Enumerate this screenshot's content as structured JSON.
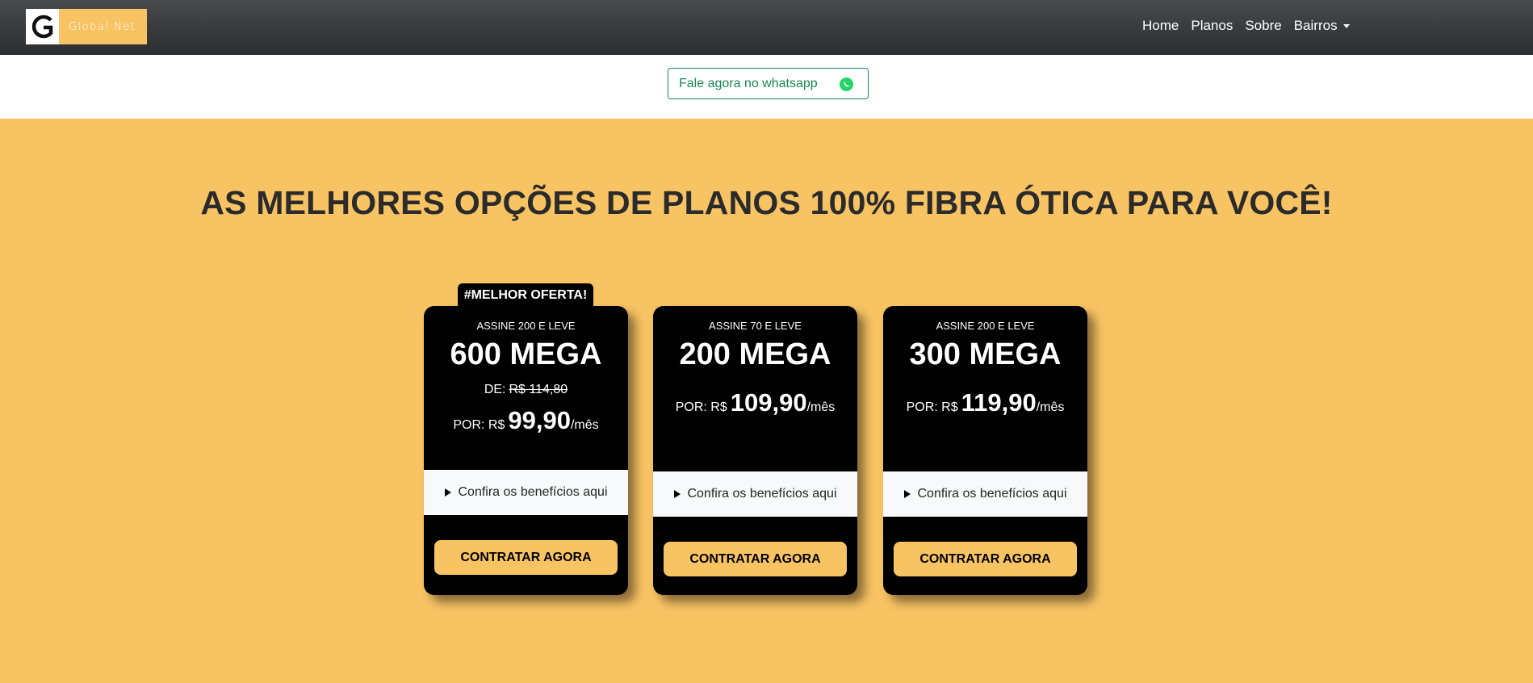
{
  "brand": {
    "name": "Global Net",
    "mark": "G",
    "color": "#f8c363"
  },
  "nav": {
    "items": [
      {
        "label": "Home"
      },
      {
        "label": "Planos"
      },
      {
        "label": "Sobre"
      },
      {
        "label": "Bairros"
      }
    ]
  },
  "whatsapp": {
    "label": "Fale agora no whatsapp",
    "icon": "whatsapp-icon",
    "color": "#198754"
  },
  "headline": "AS MELHORES OPÇÕES DE PLANOS 100% FIBRA ÓTICA PARA VOCÊ!",
  "plans": [
    {
      "badge": "#MELHOR OFERTA!",
      "subtitle": "ASSINE 200 E LEVE",
      "speed": "600 MEGA",
      "de_label": "DE:",
      "de_price": "R$ 114,80",
      "por_label": "POR: R$",
      "price": "99,90",
      "period": "/mês",
      "benefits": "Confira os benefícios aqui",
      "cta": "CONTRATAR AGORA"
    },
    {
      "subtitle": "ASSINE 70 E LEVE",
      "speed": "200 MEGA",
      "por_label": "POR: R$",
      "price": "109,90",
      "period": "/mês",
      "benefits": "Confira os benefícios aqui",
      "cta": "CONTRATAR AGORA"
    },
    {
      "subtitle": "ASSINE 200 E LEVE",
      "speed": "300 MEGA",
      "por_label": "POR: R$",
      "price": "119,90",
      "period": "/mês",
      "benefits": "Confira os benefícios aqui",
      "cta": "CONTRATAR AGORA"
    }
  ]
}
